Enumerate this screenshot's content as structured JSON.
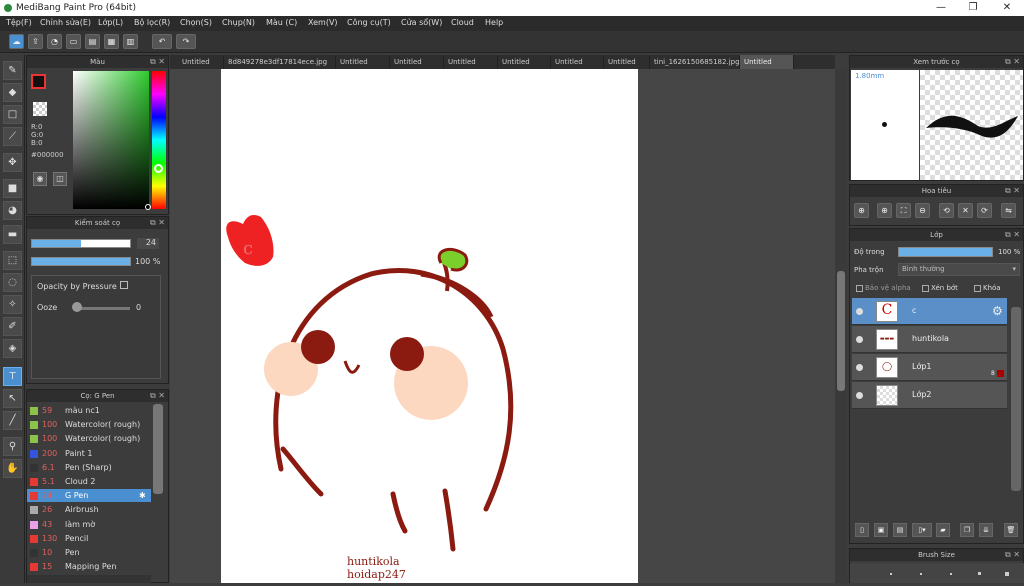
{
  "title": "MediBang Paint Pro (64bit)",
  "window_controls": {
    "minimize": "—",
    "maximize": "❐",
    "close": "✕"
  },
  "menu": [
    "Tệp(F)",
    "Chỉnh sửa(E)",
    "Lớp(L)",
    "Bộ lọc(R)",
    "Chọn(S)",
    "Chụp(N)",
    "Màu (C)",
    "Xem(V)",
    "Công cụ(T)",
    "Cửa sổ(W)",
    "Cloud",
    "Help"
  ],
  "tabs": [
    "Untitled",
    "8d849278e3df17814ece.jpg",
    "Untitled",
    "Untitled",
    "Untitled",
    "Untitled",
    "Untitled",
    "Untitled",
    "tini_1626150685182.jpg",
    "Untitled"
  ],
  "color_panel": {
    "title": "Màu",
    "r": "R:0",
    "g": "G:0",
    "b": "B:0",
    "hex": "#000000"
  },
  "brush_control": {
    "title": "Kiểm soát cọ",
    "size": "24",
    "opacity": "100 %",
    "opacity_pressure_label": "Opacity by Pressure",
    "ooze_label": "Ooze",
    "ooze_value": "0"
  },
  "brush_panel": {
    "title": "Cọ: G Pen",
    "items": [
      {
        "size": "59",
        "name": "màu nc1",
        "color": "#8bc34a"
      },
      {
        "size": "100",
        "name": "Watercolor( rough)",
        "color": "#8bc34a"
      },
      {
        "size": "100",
        "name": "Watercolor( rough)",
        "color": "#8bc34a"
      },
      {
        "size": "200",
        "name": "Paint 1",
        "color": "#3355dd"
      },
      {
        "size": "6.1",
        "name": "Pen (Sharp)",
        "color": "#333333"
      },
      {
        "size": "5.1",
        "name": "Cloud 2",
        "color": "#e53935"
      },
      {
        "size": "24",
        "name": "G Pen",
        "color": "#e53935"
      },
      {
        "size": "26",
        "name": "Airbrush",
        "color": "#aaaaaa"
      },
      {
        "size": "43",
        "name": "làm mờ",
        "color": "#e9a0e9"
      },
      {
        "size": "130",
        "name": "Pencil",
        "color": "#e53935"
      },
      {
        "size": "10",
        "name": "Pen",
        "color": "#333333"
      },
      {
        "size": "15",
        "name": "Mapping Pen",
        "color": "#e53935"
      }
    ]
  },
  "preview_panel": {
    "title": "Xem trước cọ",
    "size": "1.80mm"
  },
  "navigator_panel": {
    "title": "Hoa tiêu"
  },
  "layer_panel": {
    "title": "Lớp",
    "opacity_label": "Độ trong",
    "opacity_value": "100 %",
    "blend_label": "Pha trộn",
    "blend_value": "Bình thường",
    "protect_alpha": "Bảo vệ alpha",
    "clipping": "Xén bớt",
    "lock": "Khóa",
    "layers": [
      {
        "name": "c"
      },
      {
        "name": "huntikola"
      },
      {
        "name": "Lớp1",
        "badge": "8"
      },
      {
        "name": "Lớp2"
      }
    ]
  },
  "brush_size_panel": {
    "title": "Brush Size"
  },
  "canvas_text": {
    "line1": "huntikola",
    "line2": "hoidap247",
    "heart_letter": "c"
  }
}
